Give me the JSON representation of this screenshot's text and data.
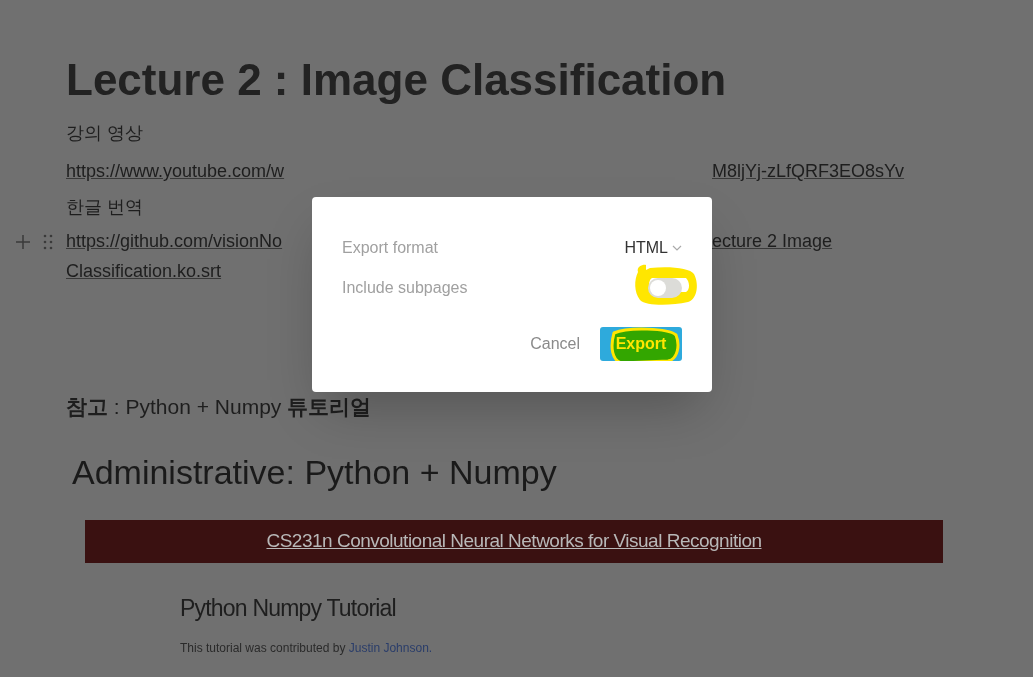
{
  "page": {
    "title": "Lecture 2 : Image Classification",
    "video_label": "강의 영상",
    "video_link": {
      "left": "https://www.youtube.com/w",
      "right": "M8ljYj-zLfQRF3EO8sYv"
    },
    "subtitle_label": "한글 번역",
    "subtitle_link": {
      "left": "https://github.com/visionNo",
      "right": "ecture 2 Image",
      "line2": "Classification.ko.srt"
    },
    "reference_heading": "**참고** : Python + Numpy **튜토리얼**",
    "slide": {
      "heading": "Administrative: Python + Numpy",
      "banner_link": "CS231n Convolutional Neural Networks for Visual Recognition",
      "tutorial_title": "Python Numpy Tutorial",
      "credit": "This tutorial was contributed by",
      "credit_link": "Justin Johnson."
    }
  },
  "dialog": {
    "rows": [
      {
        "kind": "select",
        "label": "Export format",
        "value": "HTML"
      },
      {
        "kind": "toggle",
        "label": "Include subpages",
        "on": false
      }
    ],
    "buttons": [
      {
        "kind": "secondary",
        "label": "Cancel"
      },
      {
        "kind": "primary",
        "label": "Export"
      }
    ]
  }
}
